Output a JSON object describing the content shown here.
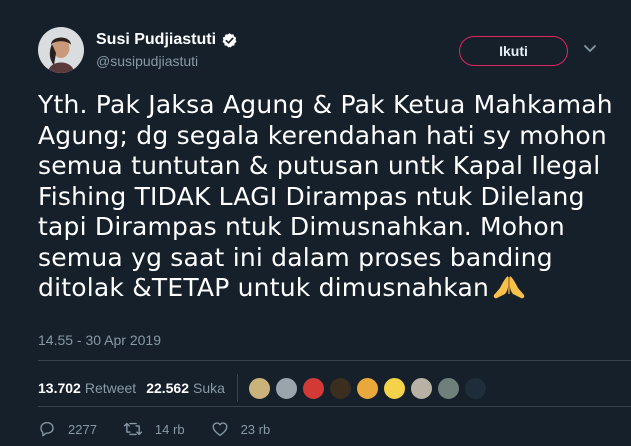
{
  "user": {
    "display_name": "Susi Pudjiastuti",
    "handle": "@susipudjiastuti",
    "verified": true
  },
  "follow_button_label": "Ikuti",
  "tweet": {
    "text": "Yth. Pak Jaksa Agung & Pak Ketua Mahkamah Agung; dg segala kerendahan hati sy mohon semua tuntutan & putusan untk Kapal Ilegal Fishing TIDAK LAGI Dirampas ntuk Dilelang tapi Dirampas ntuk Dimusnahkan. Mohon semua yg saat ini dalam proses banding ditolak &TETAP untuk dimusnahkan",
    "emoji": "folded-hands-emoji",
    "timestamp": "14.55 - 30 Apr 2019"
  },
  "stats": {
    "retweets_count": "13.702",
    "retweets_label": "Retweet",
    "likes_count": "22.562",
    "likes_label": "Suka"
  },
  "liker_avatars": [
    "#c9b37a",
    "#9aa4ad",
    "#d33a35",
    "#3b2e1e",
    "#e8a93a",
    "#f4d24a",
    "#b9b2a4",
    "#6f7f7a",
    "#1f2d3a"
  ],
  "actions": {
    "reply_count": "2277",
    "retweet_count": "14 rb",
    "like_count": "23 rb"
  },
  "colors": {
    "background": "#15202b",
    "follow_border": "#e0245e",
    "verified_badge": "#ffffff",
    "muted_text": "#8899a6"
  }
}
